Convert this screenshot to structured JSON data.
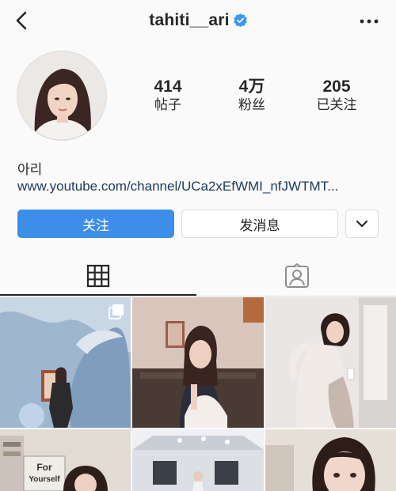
{
  "header": {
    "username": "tahiti__ari"
  },
  "profile": {
    "stats": [
      {
        "value": "414",
        "label": "帖子"
      },
      {
        "value": "4万",
        "label": "粉丝"
      },
      {
        "value": "205",
        "label": "已关注"
      }
    ],
    "name": "아리",
    "link": "www.youtube.com/channel/UCa2xEfWMI_nfJWTMT..."
  },
  "actions": {
    "follow_label": "关注",
    "message_label": "发消息"
  },
  "tabs": {
    "active": "grid"
  },
  "colors": {
    "accent": "#3d8ee9",
    "verified": "#3897f0",
    "text": "#262626"
  },
  "icons": [
    "back-arrow-icon",
    "verified-badge-icon",
    "more-options-icon",
    "chevron-down-icon",
    "grid-icon",
    "tagged-person-icon",
    "multiple-posts-icon"
  ]
}
